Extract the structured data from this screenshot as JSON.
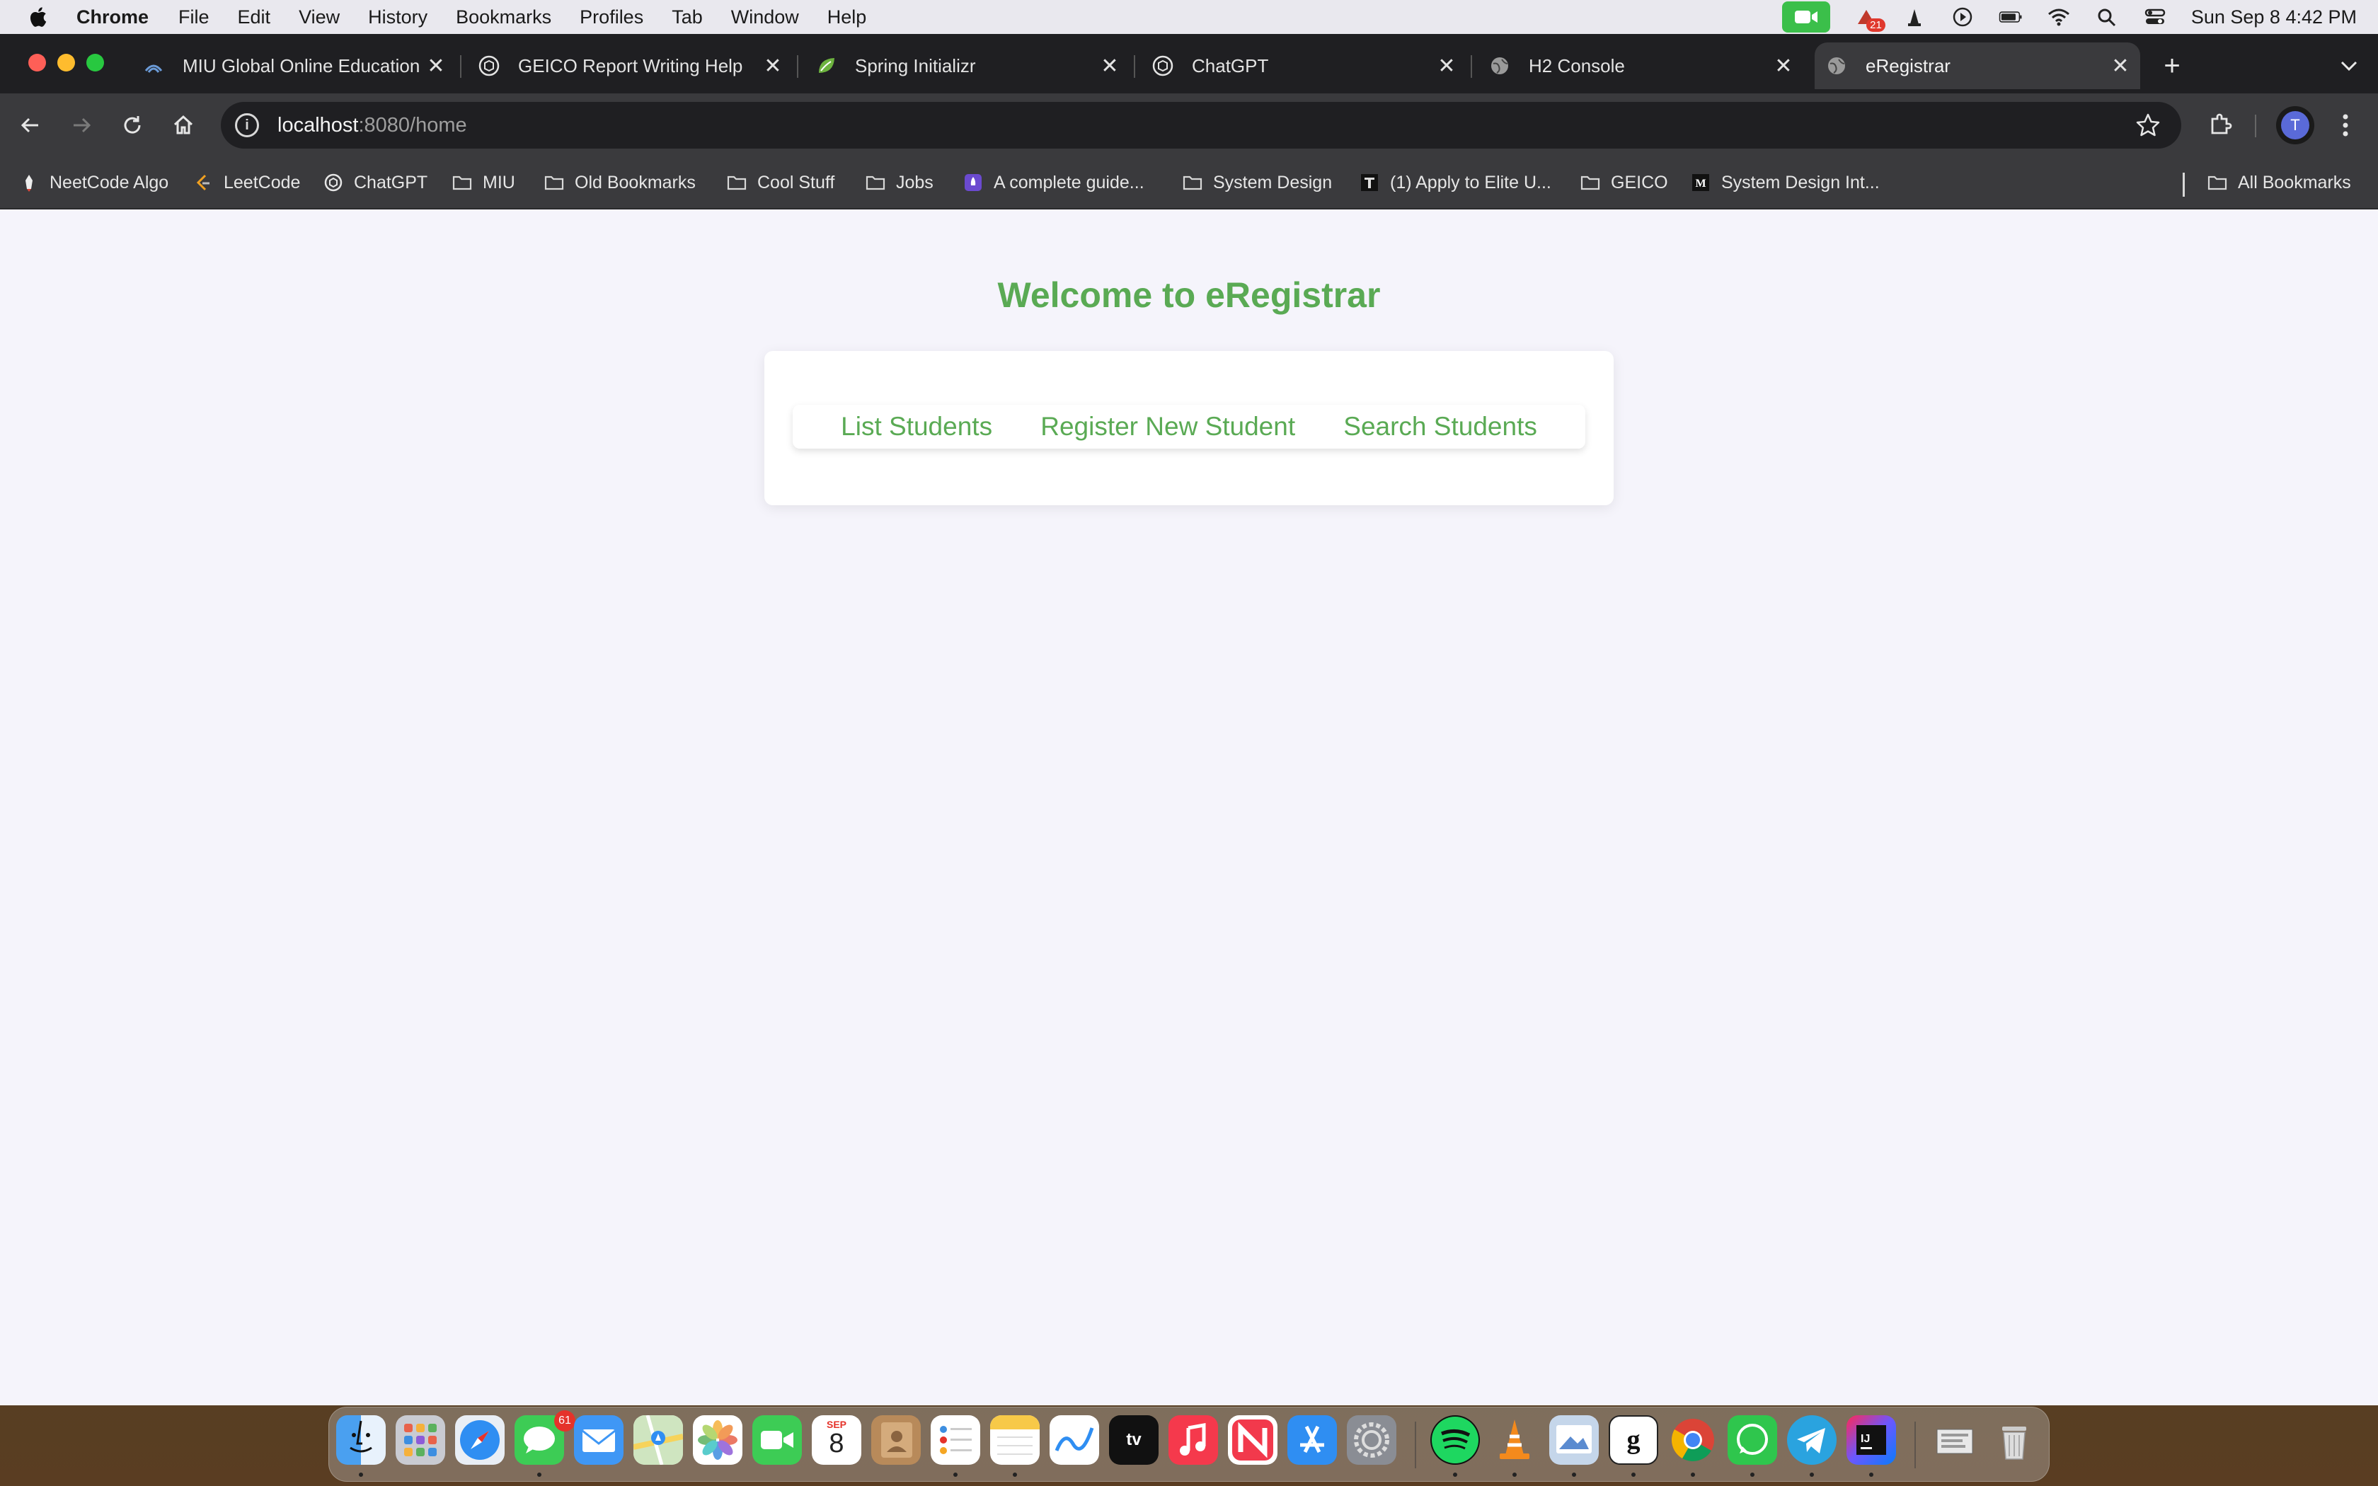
{
  "menubar": {
    "app_name": "Chrome",
    "items": [
      "File",
      "Edit",
      "View",
      "History",
      "Bookmarks",
      "Profiles",
      "Tab",
      "Window",
      "Help"
    ],
    "notification_badge": "21",
    "clock": "Sun Sep 8  4:42 PM"
  },
  "tabs": [
    {
      "title": "MIU Global Online Education",
      "icon": "miu-icon",
      "active": false
    },
    {
      "title": "GEICO Report Writing Help",
      "icon": "chatgpt-icon",
      "active": false
    },
    {
      "title": "Spring Initializr",
      "icon": "spring-icon",
      "active": false
    },
    {
      "title": "ChatGPT",
      "icon": "chatgpt-icon",
      "active": false
    },
    {
      "title": "H2 Console",
      "icon": "globe-icon",
      "active": false
    },
    {
      "title": "eRegistrar",
      "icon": "globe-icon",
      "active": true
    }
  ],
  "omnibox": {
    "host": "localhost",
    "path": ":8080/home"
  },
  "profile_initial": "T",
  "bookmarks": [
    {
      "label": "NeetCode Algo",
      "icon": "neetcode-icon"
    },
    {
      "label": "LeetCode",
      "icon": "leetcode-icon"
    },
    {
      "label": "ChatGPT",
      "icon": "chatgpt-icon"
    },
    {
      "label": "MIU",
      "icon": "folder-icon"
    },
    {
      "label": "Old Bookmarks",
      "icon": "folder-icon"
    },
    {
      "label": "Cool Stuff",
      "icon": "folder-icon"
    },
    {
      "label": "Jobs",
      "icon": "folder-icon"
    },
    {
      "label": "A complete guide...",
      "icon": "rocket-icon"
    },
    {
      "label": "System Design",
      "icon": "folder-icon"
    },
    {
      "label": "(1) Apply to Elite U...",
      "icon": "elite-icon"
    },
    {
      "label": "GEICO",
      "icon": "folder-icon"
    },
    {
      "label": "System Design Int...",
      "icon": "medium-icon"
    }
  ],
  "all_bookmarks_label": "All Bookmarks",
  "page": {
    "title": "Welcome to eRegistrar",
    "nav": {
      "list_students": "List Students",
      "register_student": "Register New Student",
      "search_students": "Search Students"
    },
    "accent_color": "#5aaa54"
  },
  "dock": {
    "calendar_month": "SEP",
    "calendar_day": "8",
    "messages_badge": "61",
    "apps": [
      "Finder",
      "Launchpad",
      "Safari",
      "Messages",
      "Mail",
      "Maps",
      "Photos",
      "FaceTime",
      "Calendar",
      "Contacts",
      "Reminders",
      "Notes",
      "Freeform",
      "TV",
      "Music",
      "News",
      "App Store",
      "System Settings",
      "Spotify",
      "VLC",
      "Preview",
      "Font Book",
      "Chrome",
      "WhatsApp",
      "Telegram",
      "IntelliJ IDEA",
      "Downloads",
      "Trash"
    ]
  }
}
